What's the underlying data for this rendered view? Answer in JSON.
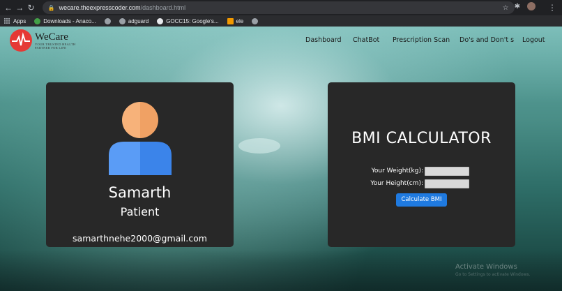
{
  "browser": {
    "url_domain": "wecare.theexpresscoder.com",
    "url_path": "/dashboard.html",
    "bookmarks": [
      {
        "label": "Apps",
        "icon": "apps-icon"
      },
      {
        "label": "Downloads - Anaco...",
        "icon": "anaconda-icon"
      },
      {
        "label": "",
        "icon": "globe-icon"
      },
      {
        "label": "adguard",
        "icon": "globe-icon"
      },
      {
        "label": "GOCC15: Google's...",
        "icon": "google-icon"
      },
      {
        "label": "ele",
        "icon": "folder-icon"
      },
      {
        "label": "",
        "icon": "globe-icon"
      }
    ]
  },
  "header": {
    "brand": "WeCare",
    "tagline_line1": "YOUR TRUSTED HEALTH",
    "tagline_line2": "PARTNER FOR LIFE",
    "nav": [
      "Dashboard",
      "ChatBot",
      "Prescription Scan",
      "Do's and Don't s",
      "Logout"
    ]
  },
  "profile": {
    "name": "Samarth",
    "role": "Patient",
    "email": "samarthnehe2000@gmail.com"
  },
  "bmi": {
    "title": "BMI CALCULATOR",
    "weight_label": "Your Weight(kg):",
    "height_label": "Your Height(cm):",
    "weight_value": "",
    "height_value": "",
    "button_label": "Calculate BMI"
  },
  "watermark": {
    "line1": "Activate Windows",
    "line2": "Go to Settings to activate Windows."
  },
  "colors": {
    "card_bg": "#282828",
    "button_bg": "#1f7ae0",
    "logo_red": "#e53935"
  }
}
